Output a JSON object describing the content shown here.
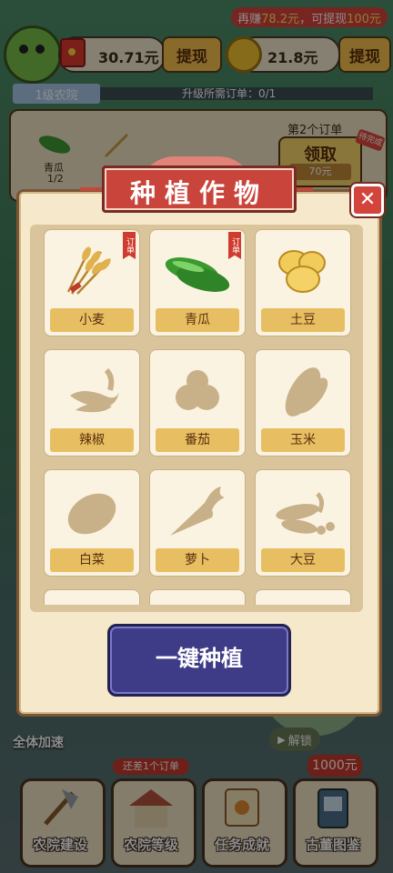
{
  "hud": {
    "banner_prefix": "再赚",
    "banner_amount": "78.2元",
    "banner_mid": "，可提现",
    "banner_target": "100元",
    "cash_value": "30.71元",
    "cash_withdraw": "提现",
    "coin_value": "21.8元",
    "coin_withdraw": "提现"
  },
  "farm": {
    "level_tag": "1级农院",
    "upgrade_text": "升级所需订单：0/1",
    "order_title": "第2个订单",
    "claim_label": "领取",
    "claim_value": "70元",
    "claim_badge": "待完成",
    "order_items": [
      {
        "name": "青瓜",
        "count": "1/2"
      }
    ]
  },
  "modal": {
    "title": "种植作物",
    "close": "✕",
    "plant_all": "一键种植",
    "order_tag": "订单",
    "crops": [
      {
        "name": "小麦",
        "icon": "wheat-icon",
        "order": true,
        "locked": false
      },
      {
        "name": "青瓜",
        "icon": "cucumber-icon",
        "order": true,
        "locked": false
      },
      {
        "name": "土豆",
        "icon": "potato-icon",
        "order": false,
        "locked": false
      },
      {
        "name": "辣椒",
        "icon": "chili-icon",
        "order": false,
        "locked": true
      },
      {
        "name": "番茄",
        "icon": "tomato-icon",
        "order": false,
        "locked": true
      },
      {
        "name": "玉米",
        "icon": "corn-icon",
        "order": false,
        "locked": true
      },
      {
        "name": "白菜",
        "icon": "cabbage-icon",
        "order": false,
        "locked": true
      },
      {
        "name": "萝卜",
        "icon": "radish-icon",
        "order": false,
        "locked": true
      },
      {
        "name": "大豆",
        "icon": "soybean-icon",
        "order": false,
        "locked": true
      }
    ]
  },
  "side": {
    "all_speed": "全体加速",
    "unlock": "解锁"
  },
  "nav": {
    "items": [
      {
        "label": "农院建设",
        "badge": ""
      },
      {
        "label": "农院等级",
        "badge": "还差1个订单"
      },
      {
        "label": "任务成就",
        "badge": ""
      },
      {
        "label": "古董图鉴",
        "badge": "1000元"
      }
    ]
  },
  "colors": {
    "modal_bg": "#f5e8cb",
    "title_red": "#c9453b",
    "label_gold": "#e7bf62",
    "plant_button": "#3e3c87",
    "locked_silhouette": "#c8b089"
  }
}
